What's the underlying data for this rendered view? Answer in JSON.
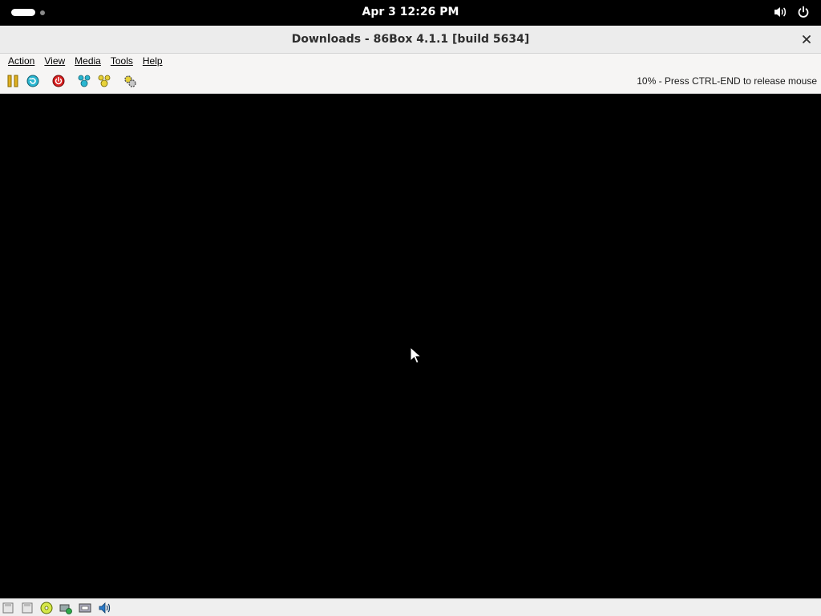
{
  "topbar": {
    "clock": "Apr 3  12:26 PM",
    "icons": [
      "activities-indicator",
      "volume-icon",
      "power-icon"
    ]
  },
  "window": {
    "title": "Downloads - 86Box 4.1.1 [build 5634]",
    "close_icon": "close-icon"
  },
  "menubar": {
    "items": [
      "Action",
      "View",
      "Media",
      "Tools",
      "Help"
    ]
  },
  "toolbar": {
    "buttons": [
      "pause-icon",
      "reset-icon",
      "power-off-icon",
      "ctrl-alt-del-icon",
      "ctrl-alt-esc-icon",
      "settings-icon"
    ],
    "status": "10% - Press CTRL-END to release mouse"
  },
  "statusbar": {
    "icons": [
      "floppy-drive-1-icon",
      "floppy-drive-2-icon",
      "cdrom-icon",
      "hard-disk-icon",
      "network-icon",
      "sound-icon"
    ]
  },
  "colors": {
    "topbar_bg": "#000000",
    "titlebar_bg": "#ececec",
    "toolbar_bg": "#f6f5f4",
    "display_bg": "#000000",
    "pause_accent": "#d4a017",
    "reset_accent": "#1b9bb5",
    "power_accent": "#d11a1a"
  }
}
